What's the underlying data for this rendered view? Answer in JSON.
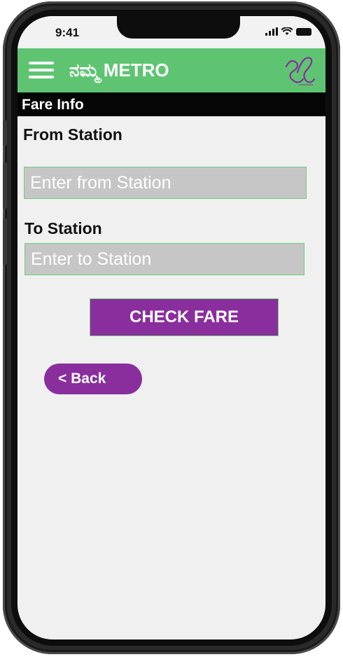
{
  "status": {
    "time": "9:41"
  },
  "app_bar": {
    "brand_kannada": "ನಮ್ಮ",
    "brand_title": "METRO",
    "menu_icon": "hamburger-menu-icon",
    "logo_icon": "logo-icon"
  },
  "section": {
    "title": "Fare Info"
  },
  "form": {
    "from_label": "From Station",
    "from_placeholder": "Enter from Station",
    "from_value": "",
    "to_label": "To Station",
    "to_placeholder": "Enter to Station",
    "to_value": "",
    "check_label": "CHECK FARE",
    "back_label": "< Back"
  },
  "colors": {
    "app_bar": "#5ec472",
    "section_bar": "#050505",
    "button": "#8a2e9e",
    "field_bg": "#c6c6c6",
    "field_border": "#6fcf7a",
    "screen_bg": "#f0f0f0"
  }
}
